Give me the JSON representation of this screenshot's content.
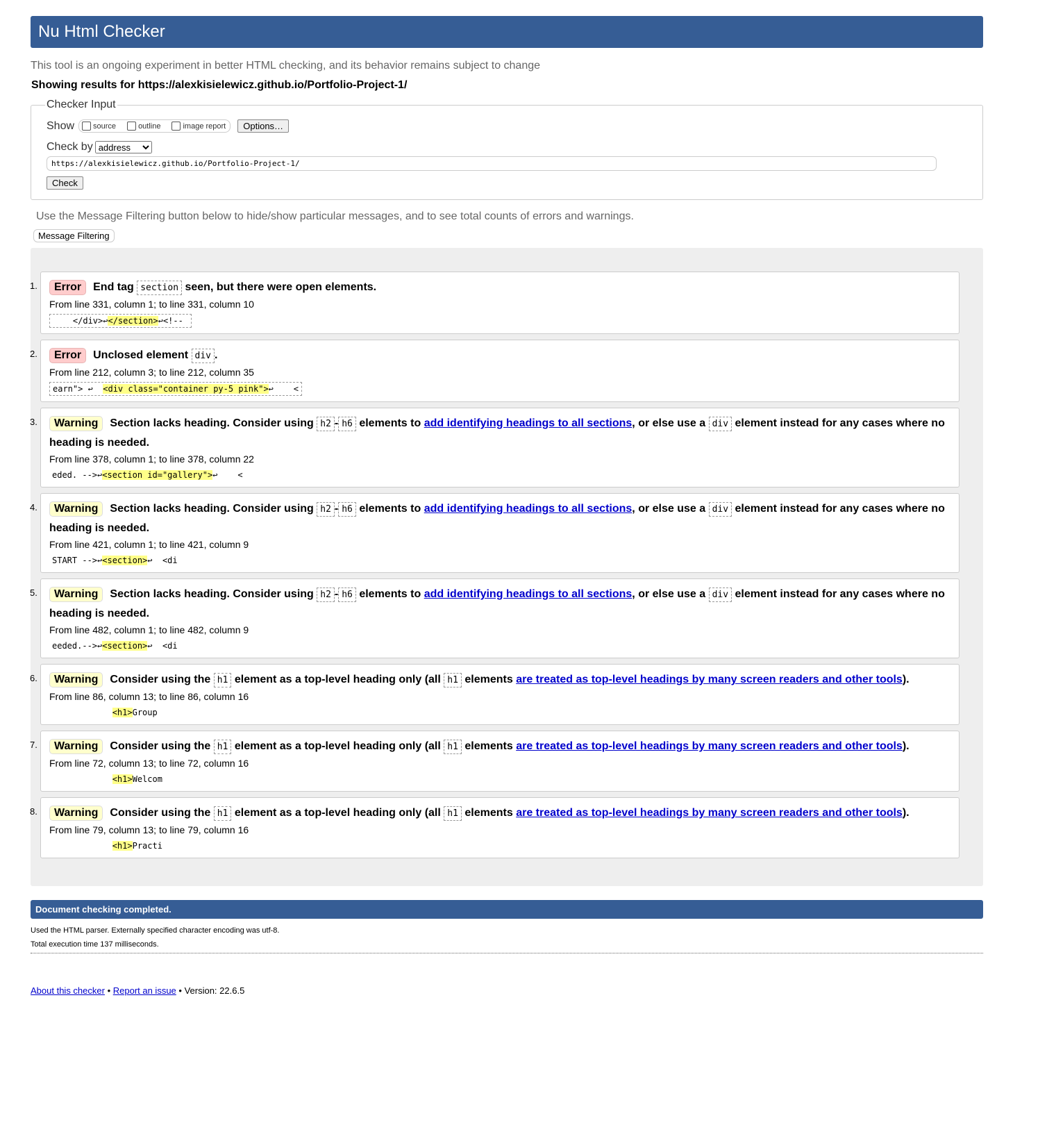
{
  "header": {
    "title": "Nu Html Checker"
  },
  "intro": "This tool is an ongoing experiment in better HTML checking, and its behavior remains subject to change",
  "showing": "Showing results for https://alexkisielewicz.github.io/Portfolio-Project-1/",
  "checker": {
    "legend": "Checker Input",
    "show_label": "Show",
    "options": [
      "source",
      "outline",
      "image report"
    ],
    "options_button": "Options…",
    "check_by_label": "Check by",
    "check_by_value": "address",
    "url": "https://alexkisielewicz.github.io/Portfolio-Project-1/",
    "check_button": "Check"
  },
  "filter_text": "Use the Message Filtering button below to hide/show particular messages, and to see total counts of errors and warnings.",
  "filter_button": "Message Filtering",
  "colors": {
    "header": "#365d95",
    "error_badge": "#ffcccc",
    "warning_badge": "#ffffcc",
    "highlight": "#ffff88"
  },
  "messages": [
    {
      "num": "1.",
      "type": "error",
      "badge": "Error",
      "parts": [
        {
          "t": "End tag "
        },
        {
          "c": "section"
        },
        {
          "t": " seen, but there were open elements."
        }
      ],
      "loc": "From line 331, column 1; to line 331, column 10",
      "ext": {
        "pre": "    </div>↩",
        "hl": "</section>",
        "post": "↩<!-- "
      },
      "boxed": true
    },
    {
      "num": "2.",
      "type": "error",
      "badge": "Error",
      "parts": [
        {
          "t": "Unclosed element "
        },
        {
          "c": "div"
        },
        {
          "t": "."
        }
      ],
      "loc": "From line 212, column 3; to line 212, column 35",
      "ext": {
        "pre": "earn\"> ↩  ",
        "hl": "<div class=\"container py-5 pink\">",
        "post": "↩    <"
      },
      "boxed": true
    },
    {
      "num": "3.",
      "type": "warning",
      "badge": "Warning",
      "parts": [
        {
          "t": "Section lacks heading. Consider using "
        },
        {
          "c": "h2"
        },
        {
          "t": "-"
        },
        {
          "c": "h6"
        },
        {
          "t": " elements to "
        },
        {
          "a": "add identifying headings to all sections"
        },
        {
          "t": ", or else use a "
        },
        {
          "c": "div"
        },
        {
          "t": " element instead for any cases where no heading is needed."
        }
      ],
      "loc": "From line 378, column 1; to line 378, column 22",
      "ext": {
        "pre": "eded. -->↩",
        "hl": "<section id=\"gallery\">",
        "post": "↩    <"
      }
    },
    {
      "num": "4.",
      "type": "warning",
      "badge": "Warning",
      "parts": [
        {
          "t": "Section lacks heading. Consider using "
        },
        {
          "c": "h2"
        },
        {
          "t": "-"
        },
        {
          "c": "h6"
        },
        {
          "t": " elements to "
        },
        {
          "a": "add identifying headings to all sections"
        },
        {
          "t": ", or else use a "
        },
        {
          "c": "div"
        },
        {
          "t": " element instead for any cases where no heading is needed."
        }
      ],
      "loc": "From line 421, column 1; to line 421, column 9",
      "ext": {
        "pre": "START -->↩",
        "hl": "<section>",
        "post": "↩  <di"
      }
    },
    {
      "num": "5.",
      "type": "warning",
      "badge": "Warning",
      "parts": [
        {
          "t": "Section lacks heading. Consider using "
        },
        {
          "c": "h2"
        },
        {
          "t": "-"
        },
        {
          "c": "h6"
        },
        {
          "t": " elements to "
        },
        {
          "a": "add identifying headings to all sections"
        },
        {
          "t": ", or else use a "
        },
        {
          "c": "div"
        },
        {
          "t": " element instead for any cases where no heading is needed."
        }
      ],
      "loc": "From line 482, column 1; to line 482, column 9",
      "ext": {
        "pre": "eeded.-->↩",
        "hl": "<section>",
        "post": "↩  <di"
      }
    },
    {
      "num": "6.",
      "type": "warning",
      "badge": "Warning",
      "parts": [
        {
          "t": "Consider using the "
        },
        {
          "c": "h1"
        },
        {
          "t": " element as a top-level heading only (all "
        },
        {
          "c": "h1"
        },
        {
          "t": " elements "
        },
        {
          "a": "are treated as top-level headings by many screen readers and other tools"
        },
        {
          "t": ")."
        }
      ],
      "loc": "From line 86, column 13; to line 86, column 16",
      "ext": {
        "pre": "            ",
        "hl": "<h1>",
        "post": "Group"
      }
    },
    {
      "num": "7.",
      "type": "warning",
      "badge": "Warning",
      "parts": [
        {
          "t": "Consider using the "
        },
        {
          "c": "h1"
        },
        {
          "t": " element as a top-level heading only (all "
        },
        {
          "c": "h1"
        },
        {
          "t": " elements "
        },
        {
          "a": "are treated as top-level headings by many screen readers and other tools"
        },
        {
          "t": ")."
        }
      ],
      "loc": "From line 72, column 13; to line 72, column 16",
      "ext": {
        "pre": "            ",
        "hl": "<h1>",
        "post": "Welcom"
      }
    },
    {
      "num": "8.",
      "type": "warning",
      "badge": "Warning",
      "parts": [
        {
          "t": "Consider using the "
        },
        {
          "c": "h1"
        },
        {
          "t": " element as a top-level heading only (all "
        },
        {
          "c": "h1"
        },
        {
          "t": " elements "
        },
        {
          "a": "are treated as top-level headings by many screen readers and other tools"
        },
        {
          "t": ")."
        }
      ],
      "loc": "From line 79, column 13; to line 79, column 16",
      "ext": {
        "pre": "            ",
        "hl": "<h1>",
        "post": "Practi"
      }
    }
  ],
  "completed": "Document checking completed.",
  "details": [
    "Used the HTML parser. Externally specified character encoding was utf-8.",
    "Total execution time 137 milliseconds."
  ],
  "footer": {
    "about": "About this checker",
    "sep1": " • ",
    "report": "Report an issue",
    "version": " • Version: 22.6.5"
  }
}
